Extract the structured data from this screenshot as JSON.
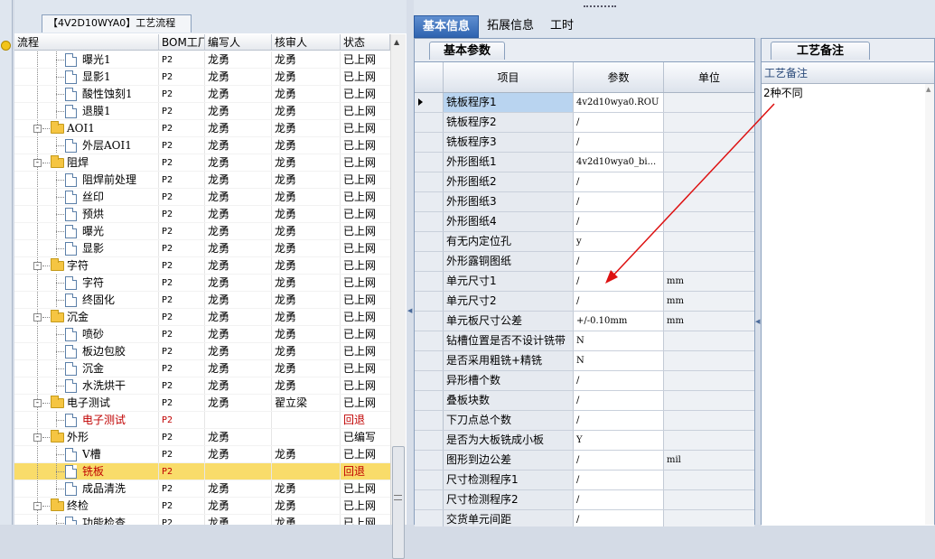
{
  "tree_panel": {
    "title": "【4V2D10WYA0】工艺流程",
    "columns": [
      "流程",
      "BOM工厂",
      "编写人",
      "核审人",
      "状态"
    ],
    "rows": [
      {
        "name": "曝光1",
        "bom": "P2",
        "author": "龙勇",
        "reviewer": "龙勇",
        "status": "已上网",
        "type": "file",
        "level": 2
      },
      {
        "name": "显影1",
        "bom": "P2",
        "author": "龙勇",
        "reviewer": "龙勇",
        "status": "已上网",
        "type": "file",
        "level": 2
      },
      {
        "name": "酸性蚀刻1",
        "bom": "P2",
        "author": "龙勇",
        "reviewer": "龙勇",
        "status": "已上网",
        "type": "file",
        "level": 2
      },
      {
        "name": "退膜1",
        "bom": "P2",
        "author": "龙勇",
        "reviewer": "龙勇",
        "status": "已上网",
        "type": "file",
        "level": 2
      },
      {
        "name": "AOI1",
        "bom": "P2",
        "author": "龙勇",
        "reviewer": "龙勇",
        "status": "已上网",
        "type": "folder",
        "level": 1
      },
      {
        "name": "外层AOI1",
        "bom": "P2",
        "author": "龙勇",
        "reviewer": "龙勇",
        "status": "已上网",
        "type": "file",
        "level": 2
      },
      {
        "name": "阻焊",
        "bom": "P2",
        "author": "龙勇",
        "reviewer": "龙勇",
        "status": "已上网",
        "type": "folder",
        "level": 1
      },
      {
        "name": "阻焊前处理",
        "bom": "P2",
        "author": "龙勇",
        "reviewer": "龙勇",
        "status": "已上网",
        "type": "file",
        "level": 2
      },
      {
        "name": "丝印",
        "bom": "P2",
        "author": "龙勇",
        "reviewer": "龙勇",
        "status": "已上网",
        "type": "file",
        "level": 2
      },
      {
        "name": "预烘",
        "bom": "P2",
        "author": "龙勇",
        "reviewer": "龙勇",
        "status": "已上网",
        "type": "file",
        "level": 2
      },
      {
        "name": "曝光",
        "bom": "P2",
        "author": "龙勇",
        "reviewer": "龙勇",
        "status": "已上网",
        "type": "file",
        "level": 2
      },
      {
        "name": "显影",
        "bom": "P2",
        "author": "龙勇",
        "reviewer": "龙勇",
        "status": "已上网",
        "type": "file",
        "level": 2
      },
      {
        "name": "字符",
        "bom": "P2",
        "author": "龙勇",
        "reviewer": "龙勇",
        "status": "已上网",
        "type": "folder",
        "level": 1
      },
      {
        "name": "字符",
        "bom": "P2",
        "author": "龙勇",
        "reviewer": "龙勇",
        "status": "已上网",
        "type": "file",
        "level": 2
      },
      {
        "name": "终固化",
        "bom": "P2",
        "author": "龙勇",
        "reviewer": "龙勇",
        "status": "已上网",
        "type": "file",
        "level": 2
      },
      {
        "name": "沉金",
        "bom": "P2",
        "author": "龙勇",
        "reviewer": "龙勇",
        "status": "已上网",
        "type": "folder",
        "level": 1
      },
      {
        "name": "喷砂",
        "bom": "P2",
        "author": "龙勇",
        "reviewer": "龙勇",
        "status": "已上网",
        "type": "file",
        "level": 2
      },
      {
        "name": "板边包胶",
        "bom": "P2",
        "author": "龙勇",
        "reviewer": "龙勇",
        "status": "已上网",
        "type": "file",
        "level": 2
      },
      {
        "name": "沉金",
        "bom": "P2",
        "author": "龙勇",
        "reviewer": "龙勇",
        "status": "已上网",
        "type": "file",
        "level": 2
      },
      {
        "name": "水洗烘干",
        "bom": "P2",
        "author": "龙勇",
        "reviewer": "龙勇",
        "status": "已上网",
        "type": "file",
        "level": 2
      },
      {
        "name": "电子测试",
        "bom": "P2",
        "author": "龙勇",
        "reviewer": "翟立梁",
        "status": "已上网",
        "type": "folder",
        "level": 1
      },
      {
        "name": "电子测试",
        "bom": "P2",
        "author": "",
        "reviewer": "",
        "status": "回退",
        "type": "file",
        "level": 2,
        "red": true
      },
      {
        "name": "外形",
        "bom": "P2",
        "author": "龙勇",
        "reviewer": "",
        "status": "已编写",
        "type": "folder",
        "level": 1
      },
      {
        "name": "V槽",
        "bom": "P2",
        "author": "龙勇",
        "reviewer": "龙勇",
        "status": "已上网",
        "type": "file",
        "level": 2
      },
      {
        "name": "铣板",
        "bom": "P2",
        "author": "",
        "reviewer": "",
        "status": "回退",
        "type": "file",
        "level": 2,
        "red": true,
        "selected": true
      },
      {
        "name": "成品清洗",
        "bom": "P2",
        "author": "龙勇",
        "reviewer": "龙勇",
        "status": "已上网",
        "type": "file",
        "level": 2
      },
      {
        "name": "终检",
        "bom": "P2",
        "author": "龙勇",
        "reviewer": "龙勇",
        "status": "已上网",
        "type": "folder",
        "level": 1
      },
      {
        "name": "功能检查",
        "bom": "P2",
        "author": "龙勇",
        "reviewer": "龙勇",
        "status": "已上网",
        "type": "file",
        "level": 2
      }
    ]
  },
  "tabs": [
    {
      "label": "基本信息",
      "active": true
    },
    {
      "label": "拓展信息",
      "active": false
    },
    {
      "label": "工时",
      "active": false
    }
  ],
  "param_panel": {
    "tab_label": "基本参数",
    "columns": [
      "项目",
      "参数",
      "单位"
    ],
    "rows": [
      {
        "item": "铣板程序1",
        "param": "4v2d10wya0.ROU",
        "unit": ""
      },
      {
        "item": "铣板程序2",
        "param": "/",
        "unit": ""
      },
      {
        "item": "铣板程序3",
        "param": "/",
        "unit": ""
      },
      {
        "item": "外形图纸1",
        "param": "4v2d10wya0_bi...",
        "unit": ""
      },
      {
        "item": "外形图纸2",
        "param": "/",
        "unit": ""
      },
      {
        "item": "外形图纸3",
        "param": "/",
        "unit": ""
      },
      {
        "item": "外形图纸4",
        "param": "/",
        "unit": ""
      },
      {
        "item": "有无内定位孔",
        "param": "y",
        "unit": ""
      },
      {
        "item": "外形露铜图纸",
        "param": "/",
        "unit": ""
      },
      {
        "item": "单元尺寸1",
        "param": "/",
        "unit": "mm"
      },
      {
        "item": "单元尺寸2",
        "param": "/",
        "unit": "mm"
      },
      {
        "item": "单元板尺寸公差",
        "param": "+/-0.10mm",
        "unit": "mm"
      },
      {
        "item": "钻槽位置是否不设计铣带",
        "param": "N",
        "unit": ""
      },
      {
        "item": "是否采用粗铣+精铣",
        "param": "N",
        "unit": ""
      },
      {
        "item": "异形槽个数",
        "param": "/",
        "unit": ""
      },
      {
        "item": "叠板块数",
        "param": "/",
        "unit": ""
      },
      {
        "item": "下刀点总个数",
        "param": "/",
        "unit": ""
      },
      {
        "item": "是否为大板铣成小板",
        "param": "Y",
        "unit": ""
      },
      {
        "item": "图形到边公差",
        "param": "/",
        "unit": "mil"
      },
      {
        "item": "尺寸检测程序1",
        "param": "/",
        "unit": ""
      },
      {
        "item": "尺寸检测程序2",
        "param": "/",
        "unit": ""
      },
      {
        "item": "交货单元间距",
        "param": "/",
        "unit": ""
      }
    ]
  },
  "note_panel": {
    "tab_label": "工艺备注",
    "header": "工艺备注",
    "text": "2种不同"
  },
  "annotation": {
    "color": "#dd1111"
  }
}
